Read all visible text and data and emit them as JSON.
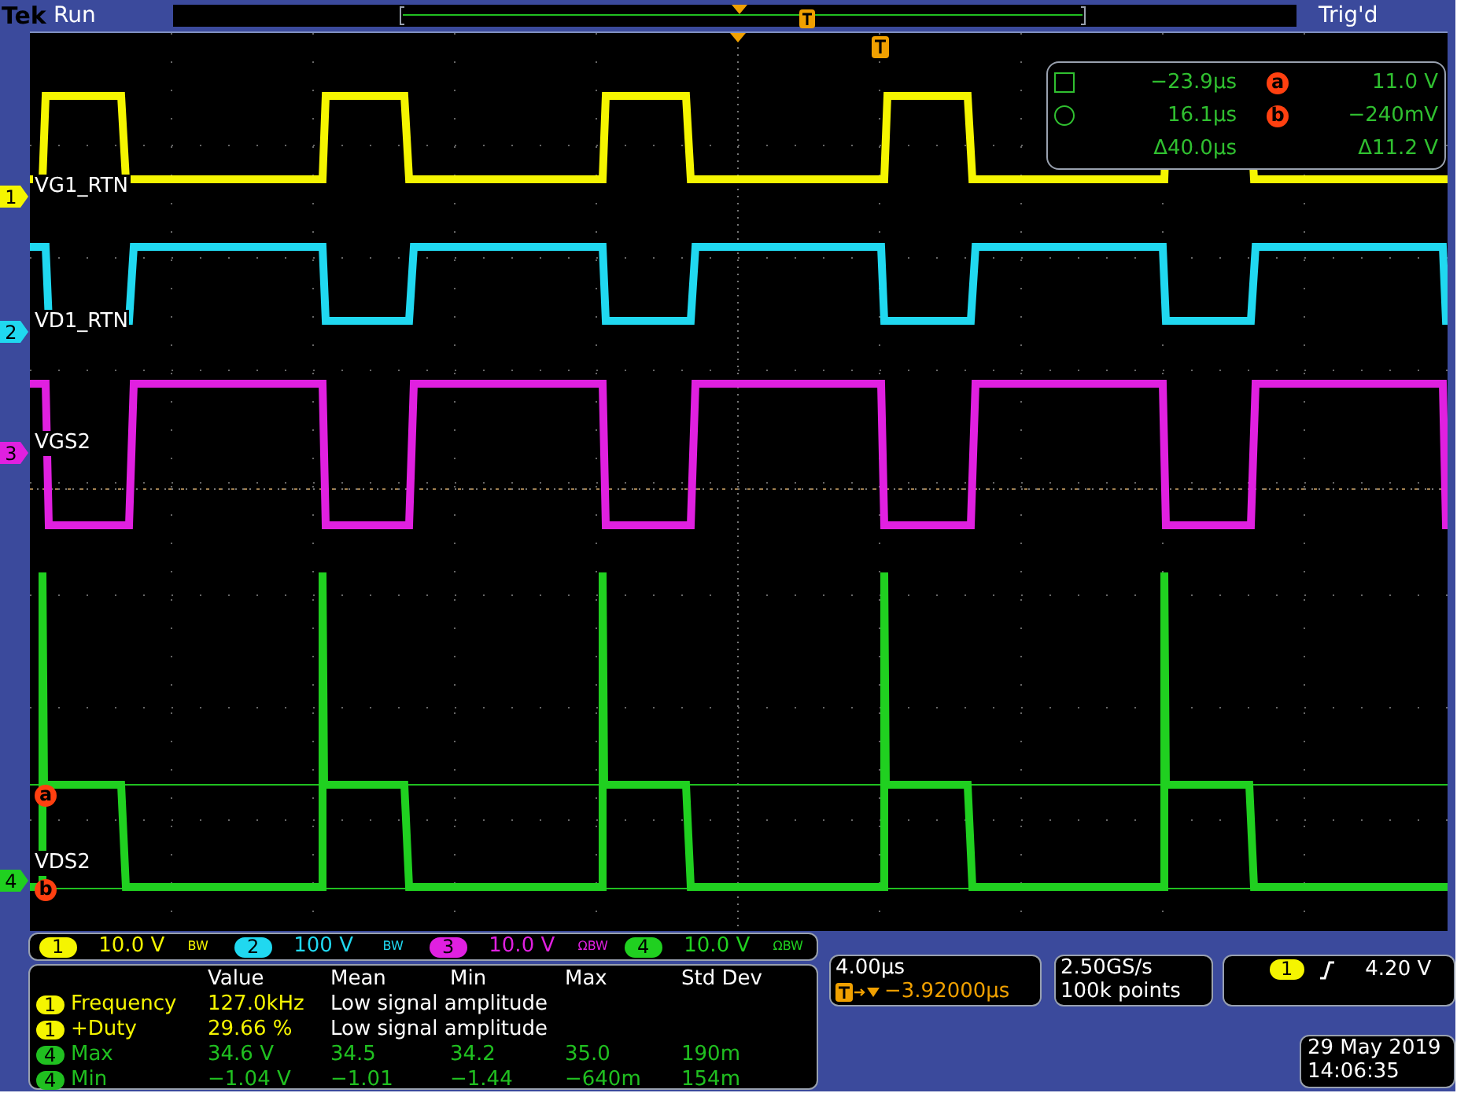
{
  "status": {
    "brand": "Tek",
    "run_state": "Run",
    "trigger_state": "Trig'd"
  },
  "channels": [
    {
      "number": "1",
      "label": "VG1_RTN",
      "color": "#f5f500"
    },
    {
      "number": "2",
      "label": "VD1_RTN",
      "color": "#20d8f0"
    },
    {
      "number": "3",
      "label": "VGS2",
      "color": "#e020e0"
    },
    {
      "number": "4",
      "label": "VDS2",
      "color": "#20d020"
    }
  ],
  "cursor_markers": [
    {
      "label": "a"
    },
    {
      "label": "b"
    }
  ],
  "cursor_readout": [
    {
      "kind": "square",
      "time": "−23.9µs",
      "marker": "a",
      "value": "11.0 V"
    },
    {
      "kind": "circle",
      "time": "16.1µs",
      "marker": "b",
      "value": "−240mV"
    },
    {
      "kind": "delta",
      "time": "Δ40.0µs",
      "value": "Δ11.2 V"
    }
  ],
  "scale_strip": [
    {
      "number": "1",
      "scale": "10.0 V",
      "flags": "BW"
    },
    {
      "number": "2",
      "scale": "100 V",
      "flags": "BW"
    },
    {
      "number": "3",
      "scale": "10.0 V",
      "flags": "ΩBW"
    },
    {
      "number": "4",
      "scale": "10.0 V",
      "flags": "ΩBW"
    }
  ],
  "measurements": {
    "headers": [
      "Value",
      "Mean",
      "Min",
      "Max",
      "Std Dev"
    ],
    "rows": [
      {
        "channel": "1",
        "name": "Frequency",
        "color": "#f5f500",
        "cells": [
          "127.0kHz",
          "Low signal amplitude"
        ]
      },
      {
        "channel": "1",
        "name": "+Duty",
        "color": "#f5f500",
        "cells": [
          "29.66 %",
          "Low signal amplitude"
        ]
      },
      {
        "channel": "4",
        "name": "Max",
        "color": "#20c020",
        "cells": [
          "34.6 V",
          "34.5",
          "34.2",
          "35.0",
          "190m"
        ]
      },
      {
        "channel": "4",
        "name": "Min",
        "color": "#20c020",
        "cells": [
          "−1.04 V",
          "−1.01",
          "−1.44",
          "−640m",
          "154m"
        ]
      }
    ]
  },
  "timebase": {
    "scale": "4.00µs",
    "delay": "−3.92000µs"
  },
  "acquisition": {
    "sample_rate": "2.50GS/s",
    "record_length": "100k points"
  },
  "trigger": {
    "source": "1",
    "level": "4.20 V"
  },
  "datetime": {
    "date": "29 May 2019",
    "time": "14:06:35"
  }
}
